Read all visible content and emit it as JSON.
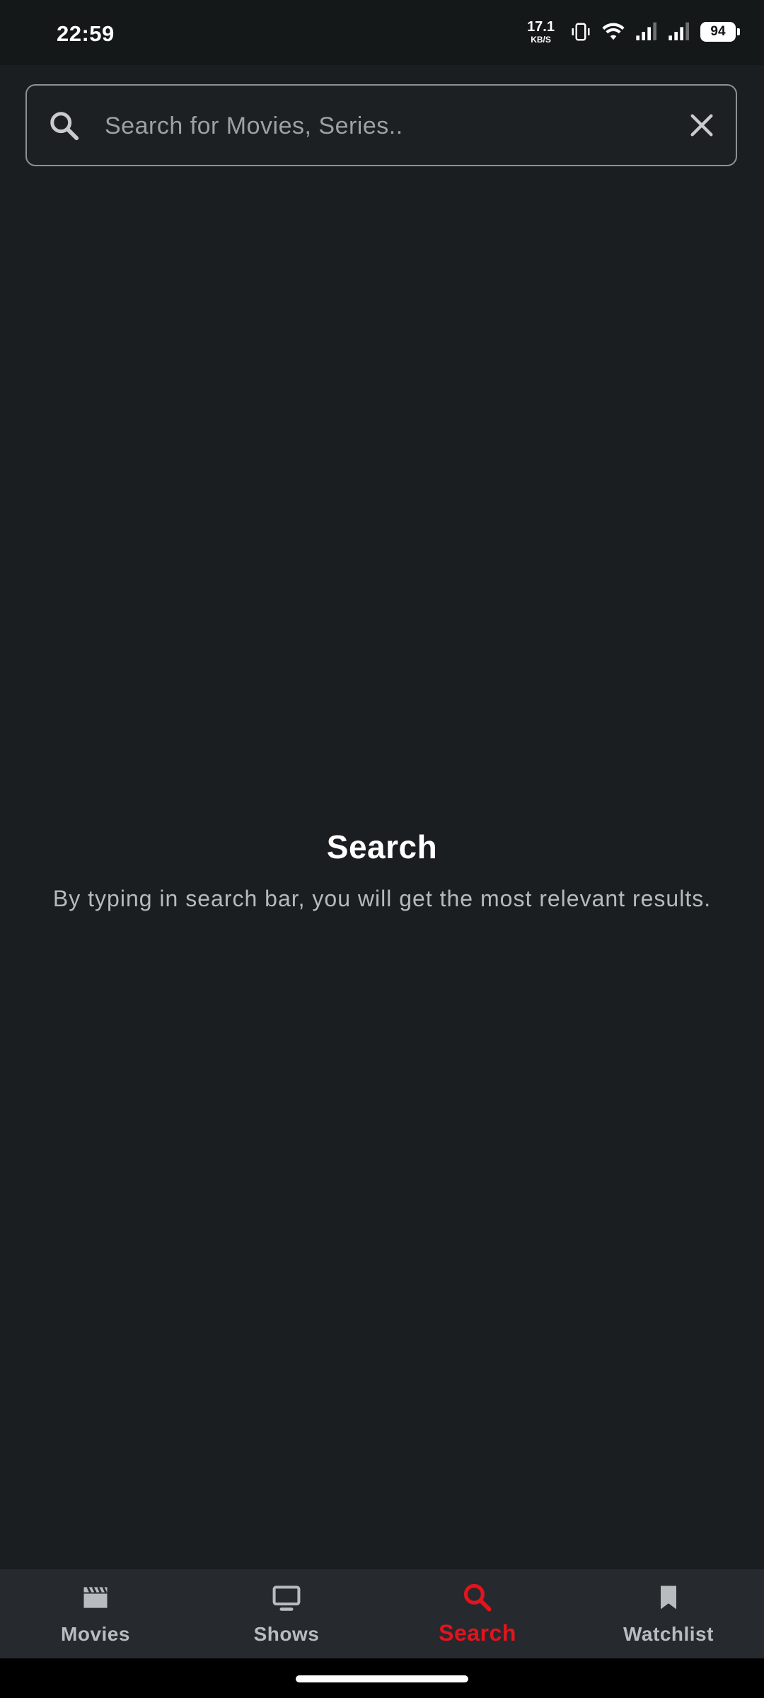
{
  "status_bar": {
    "time": "22:59",
    "net_speed_value": "17.1",
    "net_speed_unit": "KB/S",
    "battery": "94"
  },
  "search": {
    "placeholder": "Search for Movies, Series..",
    "value": "",
    "search_icon": "search-icon",
    "clear_icon": "close-icon"
  },
  "empty_state": {
    "title": "Search",
    "description": "By typing in search bar, you will get the most relevant results."
  },
  "bottom_nav": {
    "items": [
      {
        "label": "Movies",
        "icon": "clapperboard-icon",
        "active": false
      },
      {
        "label": "Shows",
        "icon": "tv-icon",
        "active": false
      },
      {
        "label": "Search",
        "icon": "search-icon",
        "active": true
      },
      {
        "label": "Watchlist",
        "icon": "bookmark-icon",
        "active": false
      }
    ]
  },
  "colors": {
    "background": "#1b1e21",
    "nav_background": "#26292e",
    "accent": "#e2141e",
    "inactive_nav": "#b9bcbf",
    "input_border": "#8e9194"
  }
}
